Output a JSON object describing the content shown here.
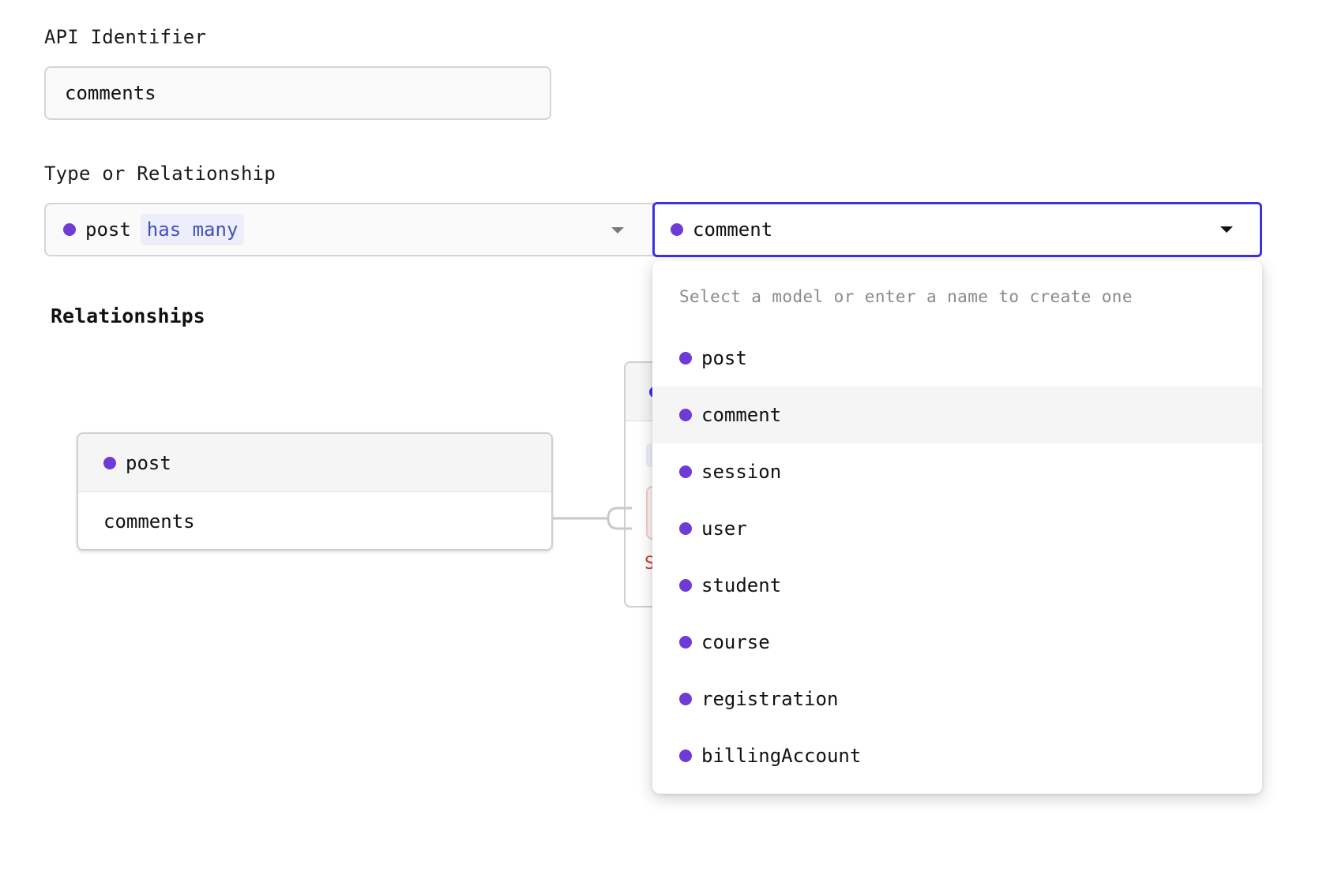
{
  "form": {
    "api_identifier_label": "API Identifier",
    "api_identifier_value": "comments",
    "type_label": "Type or Relationship",
    "source_model": "post",
    "relationship_type": "has many",
    "target_model": "comment"
  },
  "relationships_section": {
    "title": "Relationships",
    "card": {
      "model": "post",
      "field": "comments"
    },
    "hidden_card_error_fragment": "S"
  },
  "dropdown": {
    "hint": "Select a model or enter a name to create one",
    "options": [
      {
        "label": "post",
        "active": false
      },
      {
        "label": "comment",
        "active": true
      },
      {
        "label": "session",
        "active": false
      },
      {
        "label": "user",
        "active": false
      },
      {
        "label": "student",
        "active": false
      },
      {
        "label": "course",
        "active": false
      },
      {
        "label": "registration",
        "active": false
      },
      {
        "label": "billingAccount",
        "active": false
      }
    ]
  },
  "colors": {
    "model_dot": "#6e3bd6",
    "focus_border": "#3b32e6",
    "relationship_tag_bg": "#eceefa",
    "relationship_tag_text": "#4550b8"
  }
}
